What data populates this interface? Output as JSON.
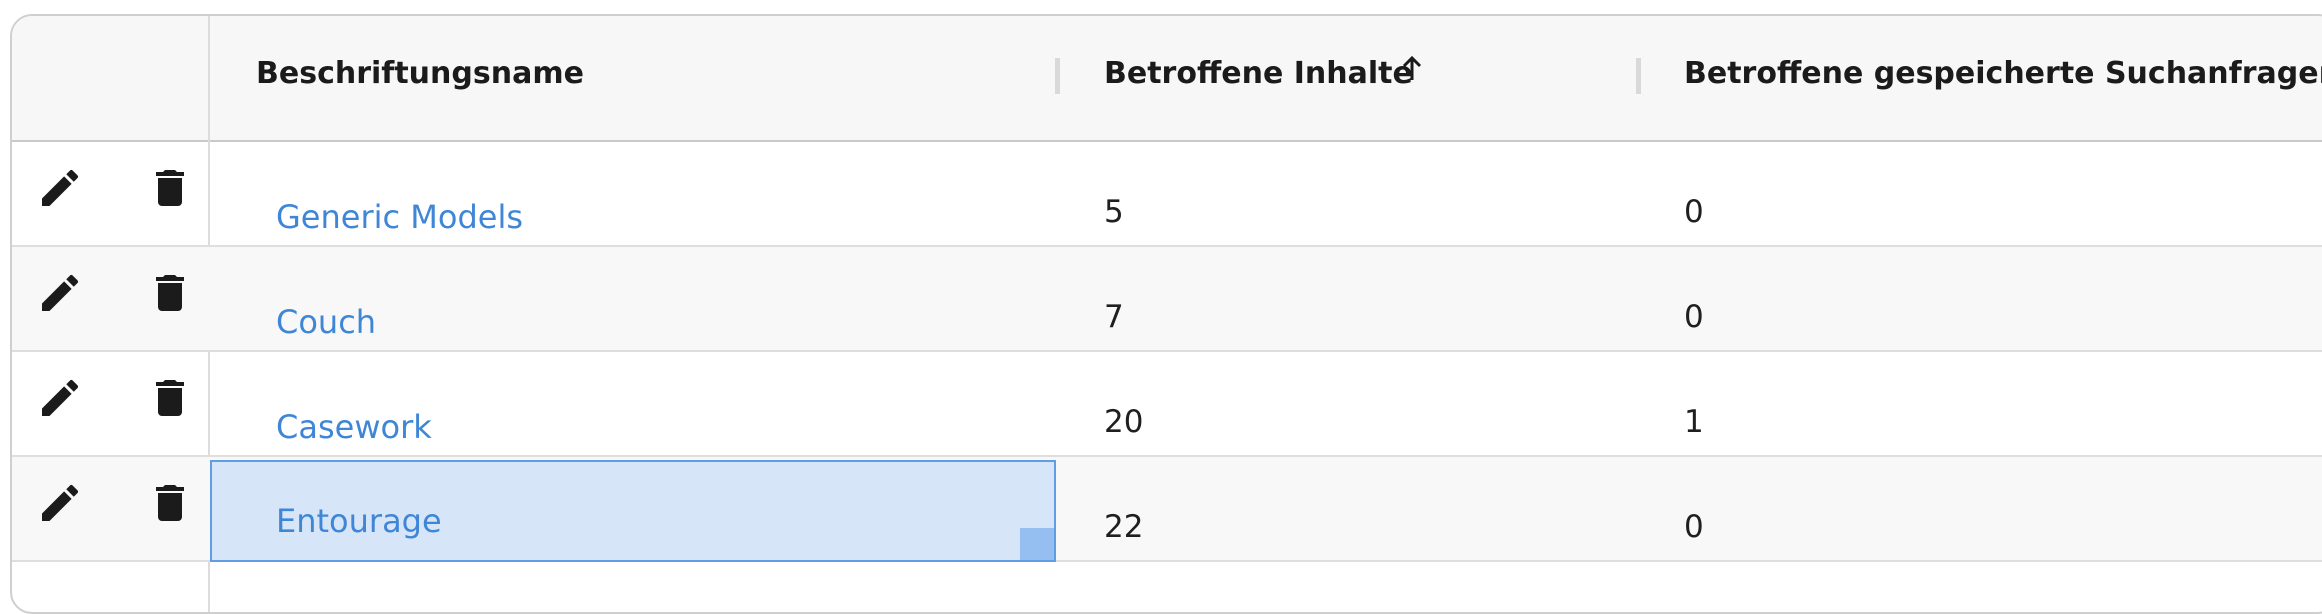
{
  "table": {
    "columns": [
      {
        "label": "Beschriftungsname"
      },
      {
        "label": "Betroffene Inhalte",
        "sort": "ascending"
      },
      {
        "label": "Betroffene gespeicherte Suchanfragen"
      }
    ],
    "rows": [
      {
        "name": "Generic Models",
        "contents": "5",
        "saved_searches": "0"
      },
      {
        "name": "Couch",
        "contents": "7",
        "saved_searches": "0"
      },
      {
        "name": "Casework",
        "contents": "20",
        "saved_searches": "1"
      },
      {
        "name": "Entourage",
        "contents": "22",
        "saved_searches": "0",
        "selected": true
      }
    ]
  },
  "icons": {
    "edit": "pencil-icon",
    "delete": "trash-icon",
    "sort": "arrow-up-icon"
  },
  "colors": {
    "link": "#3f87d6",
    "selection": "#d6e6f8",
    "selection_border": "#5f9ee5"
  }
}
